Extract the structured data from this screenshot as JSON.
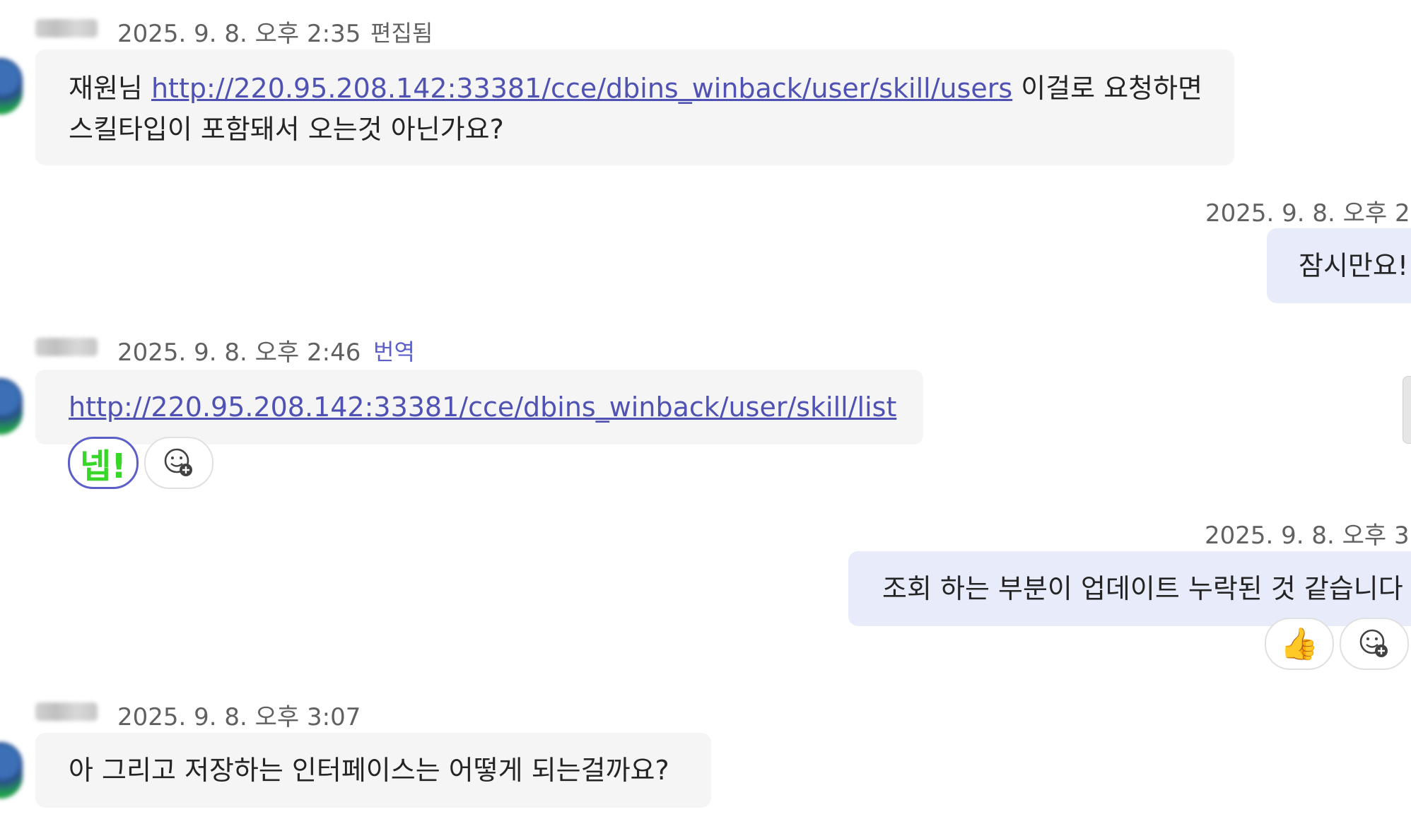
{
  "messages": [
    {
      "timestamp": "2025. 9. 8. 오후 2:35",
      "tag": "편집됨",
      "text_before": "재원님 ",
      "link": "http://220.95.208.142:33381/cce/dbins_winback/user/skill/users",
      "text_after": " 이걸로 요청하면",
      "line2": "스킬타입이 포함돼서 오는것 아닌가요?"
    },
    {
      "timestamp": "2025. 9. 8. 오후 2:",
      "text": "잠시만요!"
    },
    {
      "timestamp": "2025. 9. 8. 오후 2:46",
      "tag": "번역",
      "link": "http://220.95.208.142:33381/cce/dbins_winback/user/skill/list",
      "reaction_label": "넵!"
    },
    {
      "timestamp": "2025. 9. 8. 오후 3:",
      "text": "조회 하는 부분이 업데이트 누락된 것 같습니다",
      "reaction_emoji": "👍"
    },
    {
      "timestamp": "2025. 9. 8. 오후 3:07",
      "text": "아 그리고 저장하는 인터페이스는 어떻게 되는걸까요?"
    }
  ],
  "icons": {
    "add_reaction": "add-reaction-icon",
    "thumbs_up": "thumbs-up-icon"
  },
  "colors": {
    "link": "#4f52b2",
    "accent": "#5b5fc7",
    "incoming_bubble": "#f5f5f5",
    "outgoing_bubble": "#e8ebfa",
    "reaction_text": "#39d62a"
  }
}
